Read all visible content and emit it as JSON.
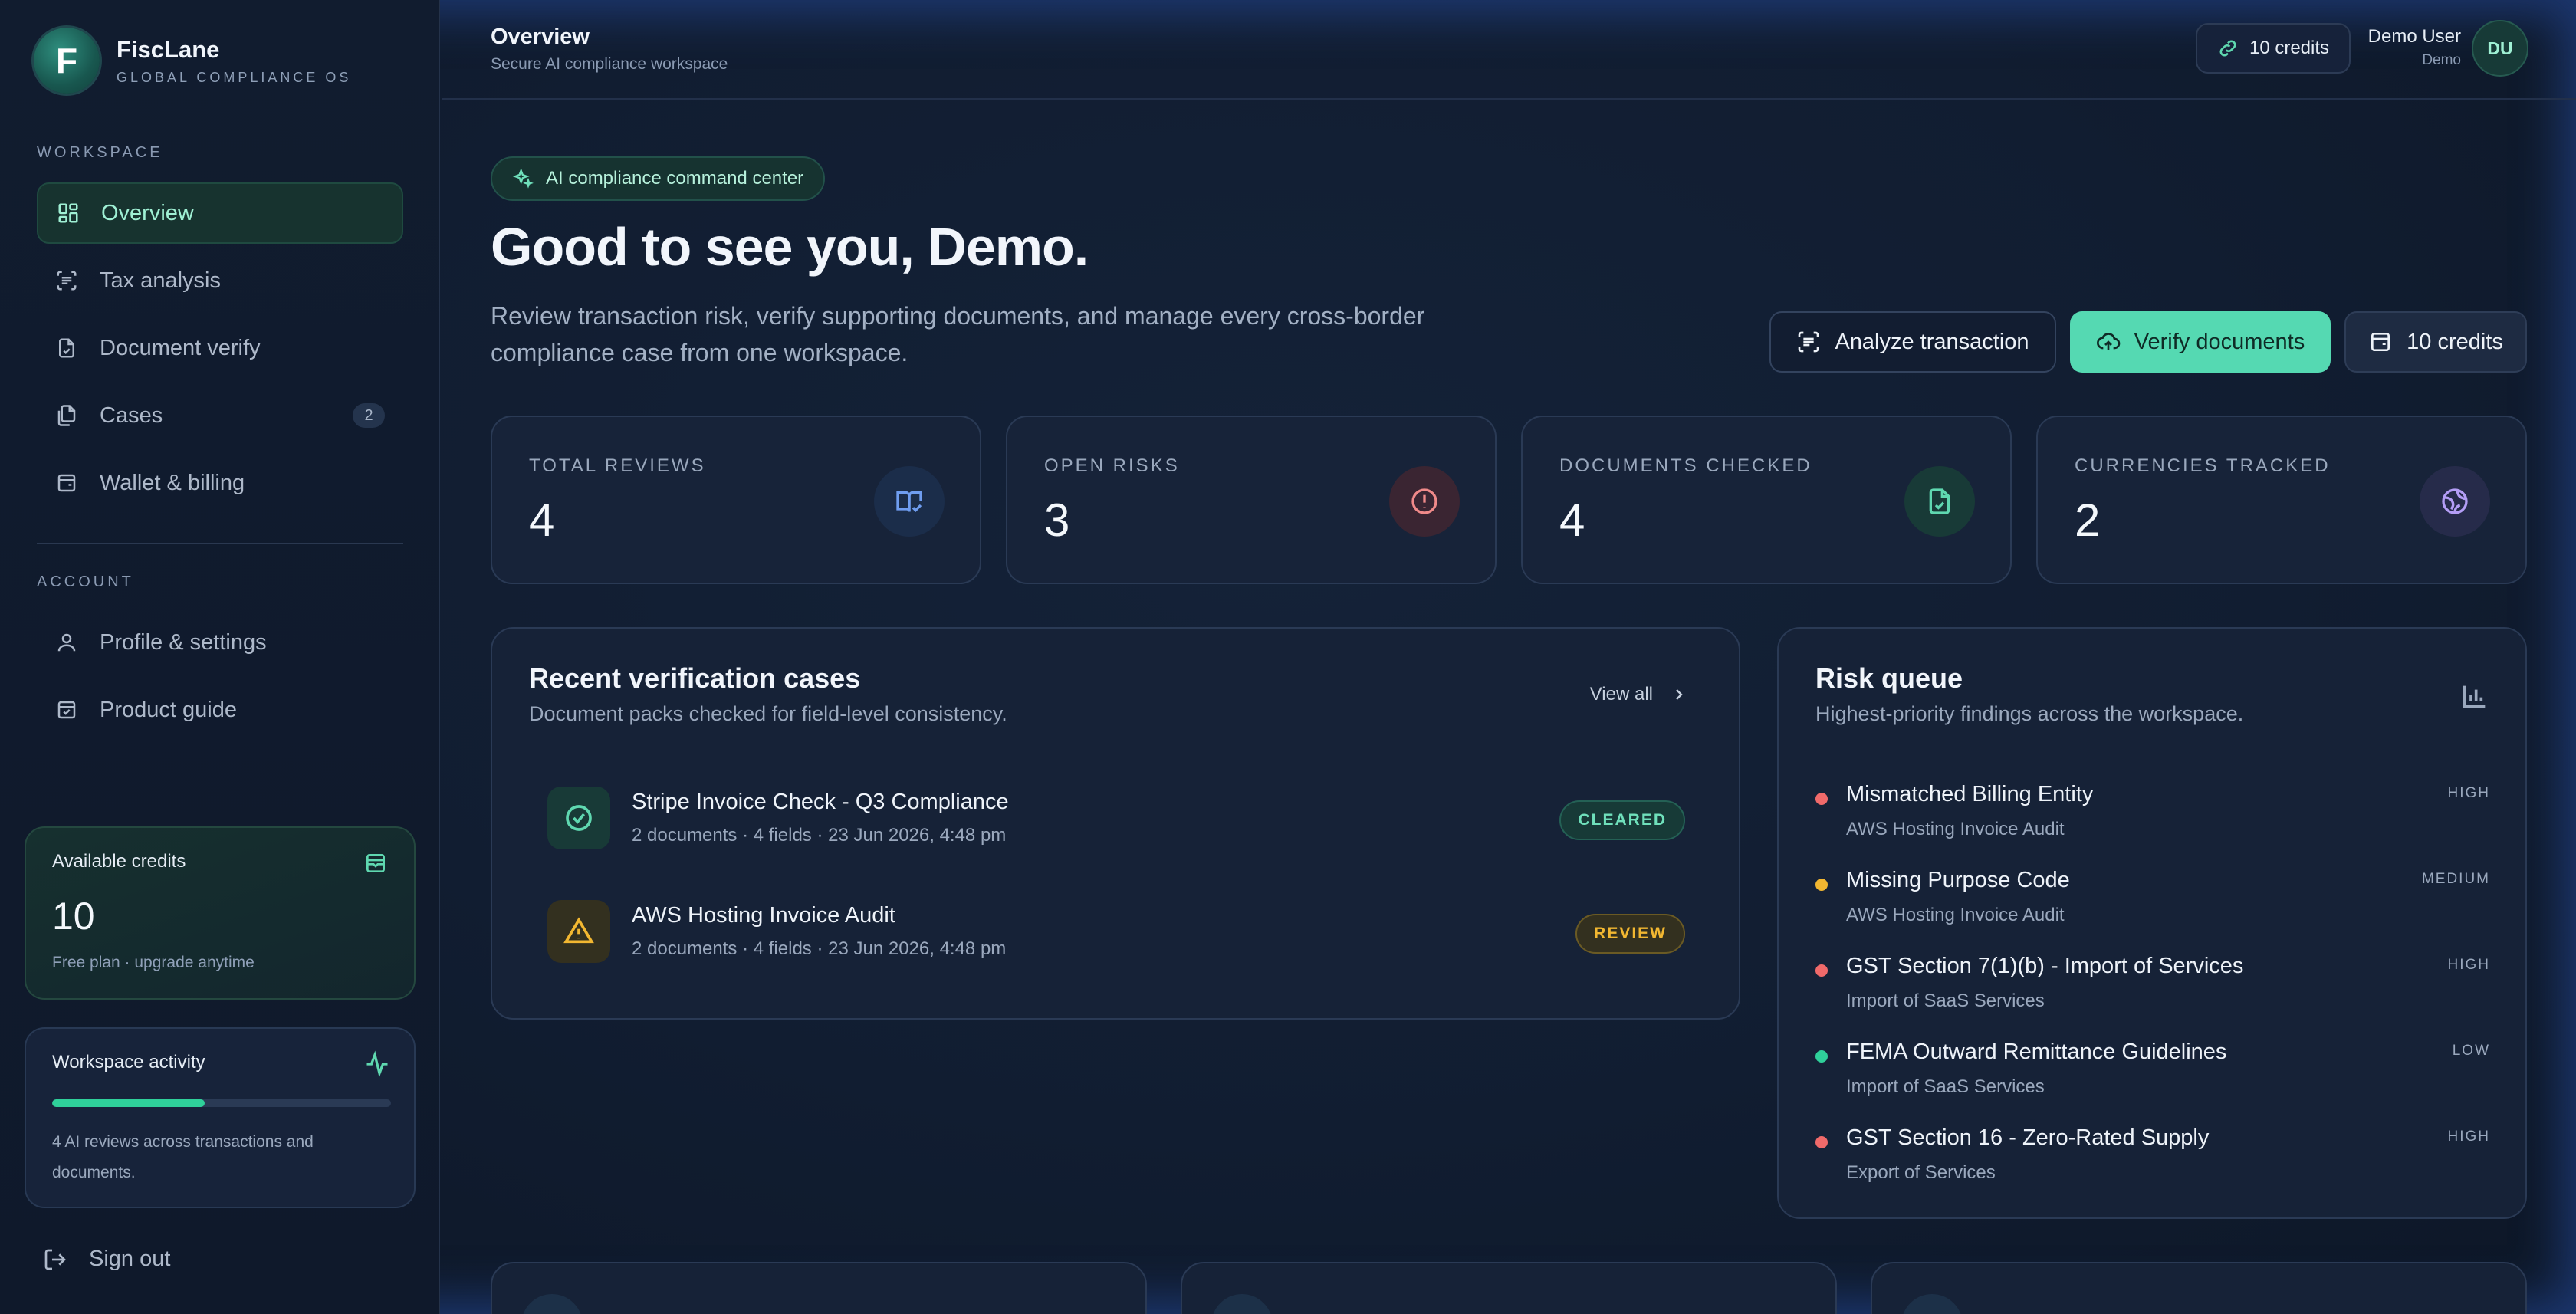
{
  "brand": {
    "logo_letter": "F",
    "name": "FiscLane",
    "tagline": "GLOBAL COMPLIANCE OS"
  },
  "sidebar": {
    "workspace_label": "WORKSPACE",
    "workspace_items": [
      {
        "label": "Overview",
        "icon": "grid-icon",
        "active": true
      },
      {
        "label": "Tax analysis",
        "icon": "scan-icon"
      },
      {
        "label": "Document verify",
        "icon": "document-icon"
      },
      {
        "label": "Cases",
        "icon": "files-icon",
        "badge": "2"
      },
      {
        "label": "Wallet & billing",
        "icon": "wallet-icon"
      }
    ],
    "account_label": "ACCOUNT",
    "account_items": [
      {
        "label": "Profile & settings",
        "icon": "user-icon"
      },
      {
        "label": "Product guide",
        "icon": "guide-icon"
      }
    ],
    "credits_card": {
      "title": "Available credits",
      "value": "10",
      "subtitle": "Free plan · upgrade anytime"
    },
    "activity_card": {
      "title": "Workspace activity",
      "progress": 0.45,
      "description": "4 AI reviews across transactions and documents."
    },
    "sign_out": "Sign out"
  },
  "topbar": {
    "title": "Overview",
    "subtitle": "Secure AI compliance workspace",
    "credits": "10 credits",
    "user_name": "Demo User",
    "user_role": "Demo",
    "avatar_initials": "DU"
  },
  "hero": {
    "pill": "AI compliance command center",
    "greeting": "Good to see you, Demo.",
    "description": "Review transaction risk, verify supporting documents, and manage every cross-border compliance case from one workspace."
  },
  "actions": {
    "analyze": "Analyze transaction",
    "verify": "Verify documents",
    "credits": "10 credits"
  },
  "stats": [
    {
      "label": "TOTAL REVIEWS",
      "value": "4",
      "icon": "book-check-icon",
      "color": "#6f9df0",
      "bg": "#1b2d4a"
    },
    {
      "label": "OPEN RISKS",
      "value": "3",
      "icon": "alert-circle-icon",
      "color": "#f08a8a",
      "bg": "#3a2532"
    },
    {
      "label": "DOCUMENTS CHECKED",
      "value": "4",
      "icon": "file-check-icon",
      "color": "#5fd8b0",
      "bg": "#183a37"
    },
    {
      "label": "CURRENCIES TRACKED",
      "value": "2",
      "icon": "globe-icon",
      "color": "#b39df5",
      "bg": "#262b4a"
    }
  ],
  "recent_cases": {
    "title": "Recent verification cases",
    "subtitle": "Document packs checked for field-level consistency.",
    "view_all": "View all",
    "items": [
      {
        "title": "Stripe Invoice Check - Q3 Compliance",
        "meta": "2 documents · 4 fields · 23 Jun 2026, 4:48 pm",
        "status": "CLEARED",
        "icon": "check-circle-icon"
      },
      {
        "title": "AWS Hosting Invoice Audit",
        "meta": "2 documents · 4 fields · 23 Jun 2026, 4:48 pm",
        "status": "REVIEW",
        "icon": "warning-icon"
      }
    ]
  },
  "risk_queue": {
    "title": "Risk queue",
    "subtitle": "Highest-priority findings across the workspace.",
    "items": [
      {
        "title": "Mismatched Billing Entity",
        "sub": "AWS Hosting Invoice Audit",
        "level": "HIGH",
        "color": "#f06a6a"
      },
      {
        "title": "Missing Purpose Code",
        "sub": "AWS Hosting Invoice Audit",
        "level": "MEDIUM",
        "color": "#f2b731"
      },
      {
        "title": "GST Section 7(1)(b) - Import of Services",
        "sub": "Import of SaaS Services",
        "level": "HIGH",
        "color": "#f06a6a"
      },
      {
        "title": "FEMA Outward Remittance Guidelines",
        "sub": "Import of SaaS Services",
        "level": "LOW",
        "color": "#2fd09a"
      },
      {
        "title": "GST Section 16 - Zero-Rated Supply",
        "sub": "Export of Services",
        "level": "HIGH",
        "color": "#f06a6a"
      }
    ]
  }
}
